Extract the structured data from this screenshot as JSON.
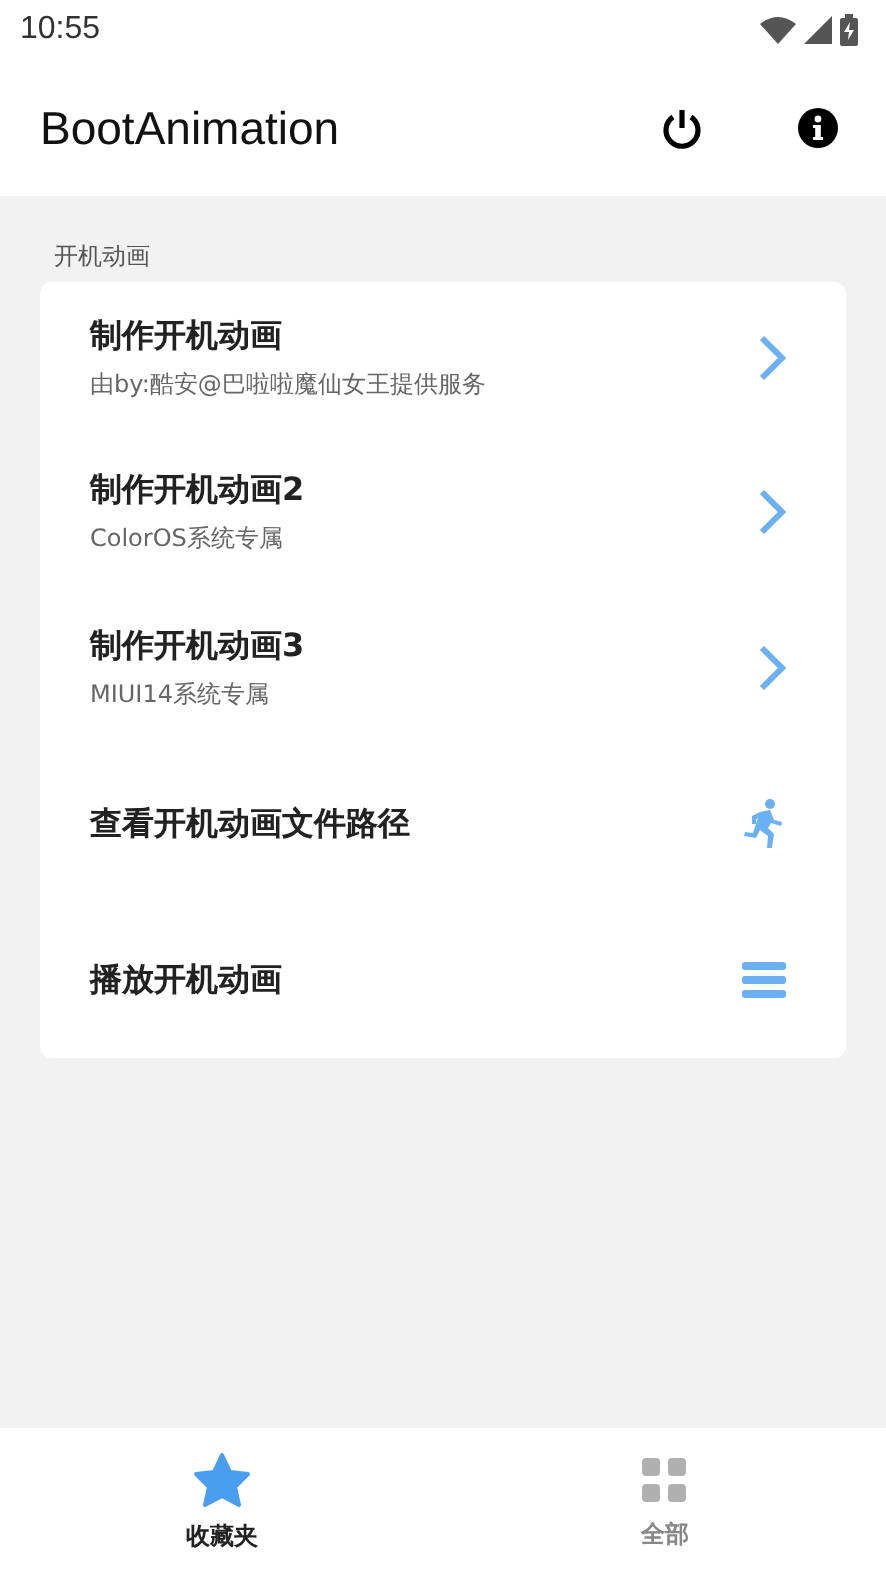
{
  "status_bar": {
    "time": "10:55"
  },
  "app_bar": {
    "title": "BootAnimation",
    "actions": [
      {
        "kind": "power"
      },
      {
        "kind": "info"
      }
    ]
  },
  "section": {
    "title": "开机动画",
    "items": [
      {
        "title": "制作开机动画",
        "subtitle": "由by:酷安@巴啦啦魔仙女王提供服务",
        "kind": "chevron"
      },
      {
        "title": "制作开机动画2",
        "subtitle": "ColorOS系统专属",
        "kind": "chevron"
      },
      {
        "title": "制作开机动画3",
        "subtitle": "MIUI14系统专属",
        "kind": "chevron"
      },
      {
        "title": "查看开机动画文件路径",
        "kind": "runner"
      },
      {
        "title": "播放开机动画",
        "kind": "list"
      }
    ]
  },
  "bottom_nav": [
    {
      "label": "收藏夹",
      "kind": "star",
      "selected": true
    },
    {
      "label": "全部",
      "kind": "grid",
      "selected": false
    }
  ]
}
